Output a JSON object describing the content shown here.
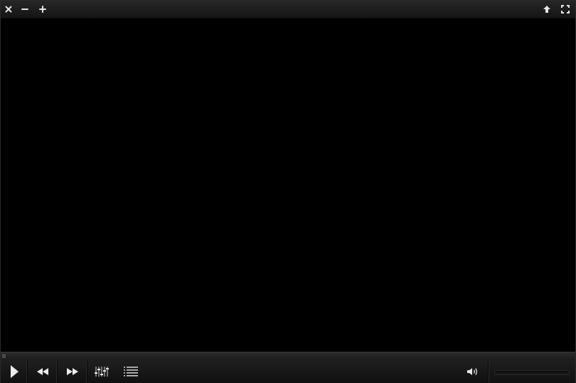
{
  "player": {
    "titlebar": {
      "icons": {
        "close": "close-icon",
        "minimize": "minimize-icon",
        "maximize": "plus-icon",
        "always_on_top": "arrow-up-icon",
        "fullscreen": "fullscreen-icon"
      }
    },
    "controls": {
      "icons": {
        "play": "play-icon",
        "rewind": "rewind-icon",
        "forward": "fast-forward-icon",
        "equalizer": "equalizer-icon",
        "playlist": "playlist-icon",
        "volume": "volume-icon"
      },
      "volume_level": 0,
      "seek_position": 0
    },
    "colors": {
      "chrome": "#1a1a1a",
      "icon": "#e6e6e6",
      "video_bg": "#000000"
    }
  }
}
